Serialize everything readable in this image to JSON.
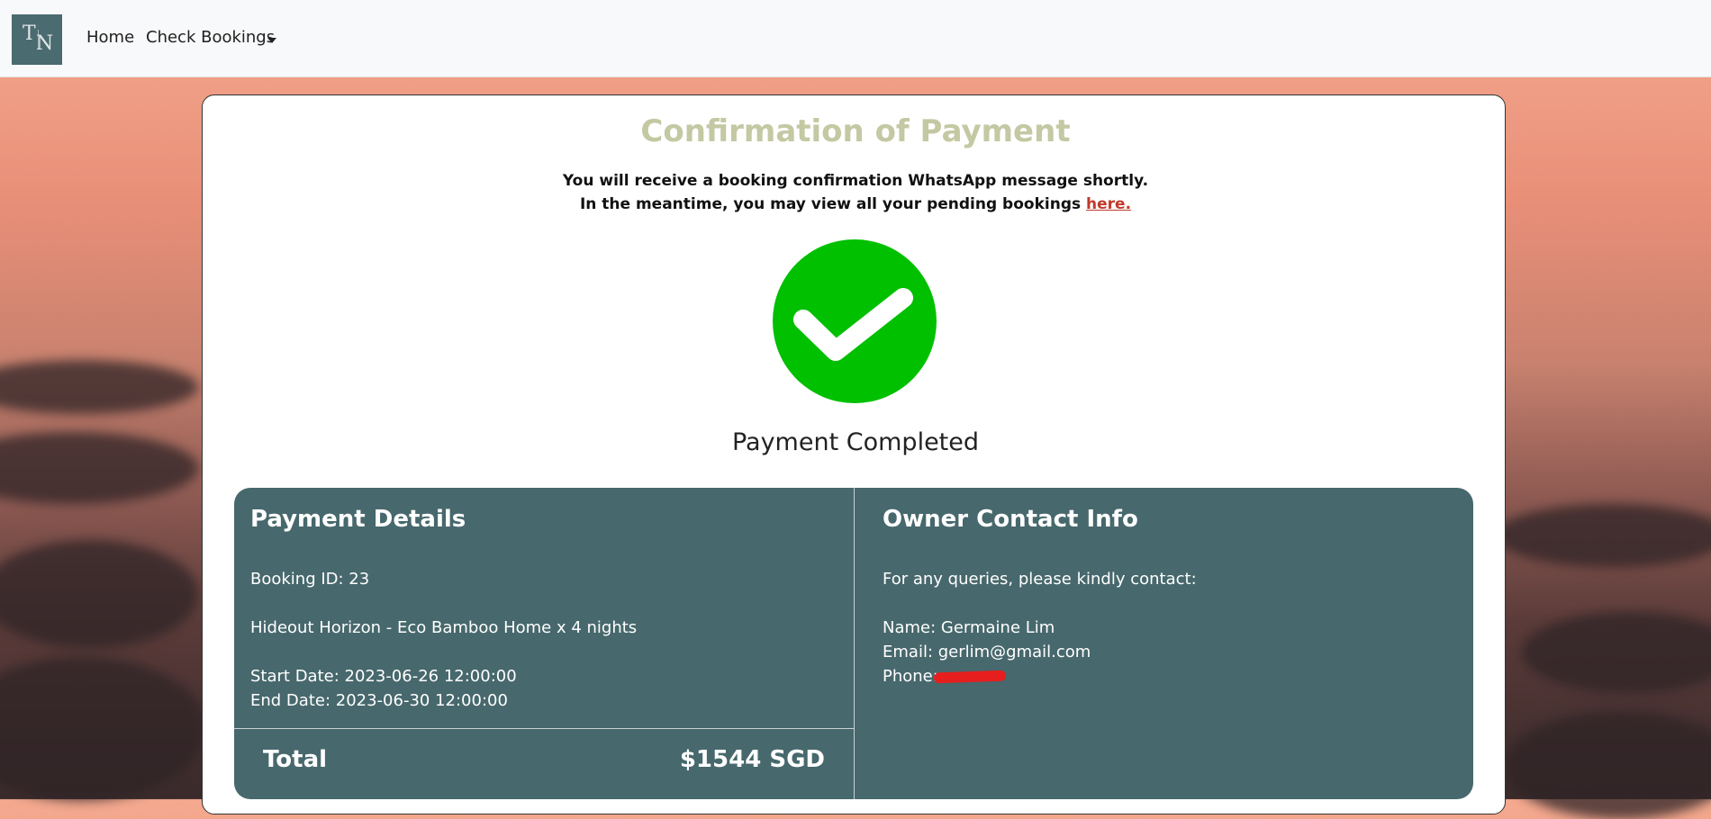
{
  "navbar": {
    "logo_text_t": "T",
    "logo_text_n": "N",
    "home_label": "Home",
    "bookings_label": "Check Bookings"
  },
  "confirmation": {
    "title": "Confirmation of Payment",
    "message_line1": "You will receive a booking confirmation WhatsApp message shortly.",
    "message_line2": "In the meantime, you may view all your pending bookings",
    "link_label": "here.",
    "status_text": "Payment Completed",
    "status_icon": "check-circle-icon",
    "status_color": "#00c000"
  },
  "payment_details": {
    "title": "Payment Details",
    "booking_id": "Booking ID: 23",
    "listing": "Hideout Horizon - Eco Bamboo Home x 4 nights",
    "start_date": "Start Date: 2023-06-26 12:00:00",
    "end_date": "End Date: 2023-06-30 12:00:00",
    "total_label": "Total",
    "total_value": "$1544 SGD"
  },
  "owner_contact": {
    "title": "Owner Contact Info",
    "intro": "For any queries, please kindly contact:",
    "name": "Name: Germaine Lim",
    "email": "Email: gerlim@gmail.com",
    "phone_label": "Phone:"
  },
  "colors": {
    "panel_bg": "#47686c",
    "title_color": "#c4c8a3",
    "link_color": "#c0392b",
    "redaction": "#e61e1e"
  }
}
